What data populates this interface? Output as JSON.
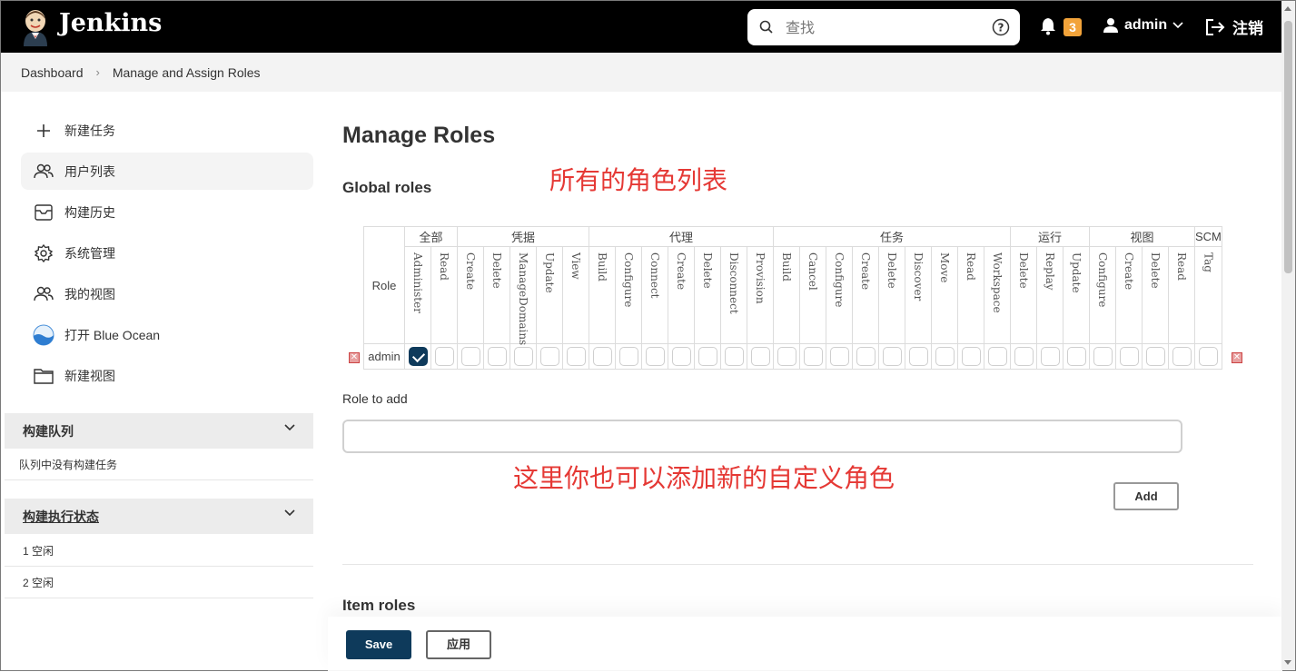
{
  "header": {
    "brand": "Jenkins",
    "search_placeholder": "查找",
    "notification_count": "3",
    "user": "admin",
    "logout_label": "注销"
  },
  "breadcrumb": [
    "Dashboard",
    "Manage and Assign Roles"
  ],
  "sidebar": {
    "tasks": [
      {
        "label": "新建任务",
        "icon": "plus-icon"
      },
      {
        "label": "用户列表",
        "icon": "users-icon"
      },
      {
        "label": "构建历史",
        "icon": "history-icon"
      },
      {
        "label": "系统管理",
        "icon": "gear-icon"
      },
      {
        "label": "我的视图",
        "icon": "users-icon"
      },
      {
        "label": "打开 Blue Ocean",
        "icon": "blue-ocean-icon"
      },
      {
        "label": "新建视图",
        "icon": "folder-icon"
      }
    ],
    "build_queue": {
      "title": "构建队列",
      "empty": "队列中没有构建任务"
    },
    "executors": {
      "title": "构建执行状态",
      "items": [
        "1  空闲",
        "2  空闲"
      ]
    }
  },
  "main": {
    "title": "Manage Roles",
    "global_roles": "Global roles",
    "annotation_top": "所有的角色列表",
    "annotation_bottom": "这里你也可以添加新的自定义角色",
    "role_header": "Role",
    "groups": [
      {
        "name": "全部",
        "perms": [
          "Administer",
          "Read"
        ]
      },
      {
        "name": "凭据",
        "perms": [
          "Create",
          "Delete",
          "ManageDomains",
          "Update",
          "View"
        ]
      },
      {
        "name": "代理",
        "perms": [
          "Build",
          "Configure",
          "Connect",
          "Create",
          "Delete",
          "Disconnect",
          "Provision"
        ]
      },
      {
        "name": "任务",
        "perms": [
          "Build",
          "Cancel",
          "Configure",
          "Create",
          "Delete",
          "Discover",
          "Move",
          "Read",
          "Workspace"
        ]
      },
      {
        "name": "运行",
        "perms": [
          "Delete",
          "Replay",
          "Update"
        ]
      },
      {
        "name": "视图",
        "perms": [
          "Configure",
          "Create",
          "Delete",
          "Read"
        ]
      },
      {
        "name": "SCM",
        "perms": [
          "Tag"
        ]
      }
    ],
    "rows": [
      {
        "role": "admin",
        "checked_index": 0
      }
    ],
    "role_to_add_label": "Role to add",
    "role_to_add_value": "",
    "add_button": "Add",
    "item_roles": "Item roles",
    "save_button": "Save",
    "apply_button": "应用"
  },
  "colors": {
    "header_bg": "#000000",
    "primary": "#0e3a5b",
    "annotation": "#e53935",
    "badge": "#f2a33a"
  }
}
